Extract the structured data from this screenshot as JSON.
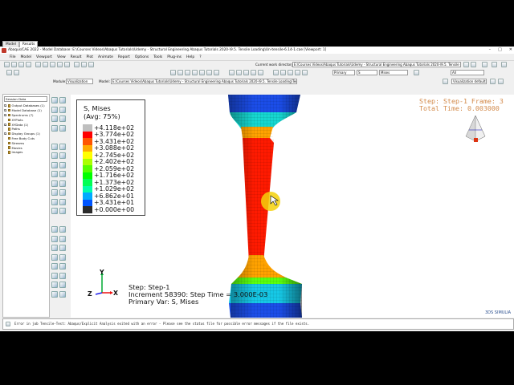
{
  "window": {
    "title": "Abaqus/CAE 2022 - Model Database: E:\\Courses Videos\\Abaqus Tutorials\\Udemy - Structural Engineering Abaqus Tutorials 2020-\\9.5. Tensile Loading\\Un-tensile-6.14-1.cae [Viewport: 1]"
  },
  "menu": [
    "File",
    "Model",
    "Viewport",
    "View",
    "Result",
    "Plot",
    "Animate",
    "Report",
    "Options",
    "Tools",
    "Plug-ins",
    "Help",
    "?"
  ],
  "toolbar": {
    "cwd_label": "Current work directory:",
    "cwd_value": "E:\\Courses Videos\\Abaqus Tutorials\\Udemy - Structural Engineering Abaqus Tutorials 2020-\\9.5. Tensile Loading",
    "all_value": "All",
    "primary_value": "Primary",
    "s_value": "S",
    "mises_value": "Mises",
    "vis_defaults": "Visualization defaults",
    "module_label": "Module:",
    "module_value": "Visualization",
    "model_label": "Model:",
    "model_value": "E:\\Courses Videos\\Abaqus Tutorials\\Udemy - Structural Engineering Abaqus Tutorials 2020-\\9.5. Tensile Loading\\Tensile-test.odb"
  },
  "panel": {
    "tabs": [
      "Model",
      "Results"
    ],
    "session": "Session Data",
    "tree": [
      {
        "label": "Output Databases (1)",
        "plus": true
      },
      {
        "label": "Model Database (1)",
        "plus": true
      },
      {
        "label": "Spectrums (7)",
        "plus": true
      },
      {
        "label": "XYPlots",
        "plus": false
      },
      {
        "label": "XYData (1)",
        "plus": true
      },
      {
        "label": "Paths",
        "plus": false
      },
      {
        "label": "Display Groups (1)",
        "plus": true
      },
      {
        "label": "Free Body Cuts",
        "plus": false
      },
      {
        "label": "Streams",
        "plus": false
      },
      {
        "label": "Movies",
        "plus": false
      },
      {
        "label": "Images",
        "plus": false
      }
    ]
  },
  "legend": {
    "title": "S, Mises",
    "subtitle": "(Avg: 75%)",
    "entries": [
      {
        "value": "+4.118e+02",
        "color": "#bfbfbf"
      },
      {
        "value": "+3.774e+02",
        "color": "#ff0000"
      },
      {
        "value": "+3.431e+02",
        "color": "#ff5500"
      },
      {
        "value": "+3.088e+02",
        "color": "#ffaa00"
      },
      {
        "value": "+2.745e+02",
        "color": "#ffff00"
      },
      {
        "value": "+2.402e+02",
        "color": "#aaff00"
      },
      {
        "value": "+2.059e+02",
        "color": "#55ff00"
      },
      {
        "value": "+1.716e+02",
        "color": "#00ff00"
      },
      {
        "value": "+1.373e+02",
        "color": "#00ff55"
      },
      {
        "value": "+1.029e+02",
        "color": "#00ffaa"
      },
      {
        "value": "+6.862e+01",
        "color": "#00aaff"
      },
      {
        "value": "+3.431e+01",
        "color": "#0055ff"
      },
      {
        "value": "+0.000e+00",
        "color": "#0000ff"
      }
    ],
    "last_color": "#2b2b2b"
  },
  "step_info": {
    "line1": "Step: Step-1   Frame: 3",
    "line2": "Total Time: 0.003000"
  },
  "triad": {
    "y": "Y",
    "z": "Z",
    "x": "X"
  },
  "viewport_text": {
    "step": "Step: Step-1",
    "increment": "Increment     58390: Step Time =    3.000E-03",
    "primary": "Primary Var: S, Mises"
  },
  "message": "Error in job Tensile-Test: Abaqus/Explicit Analysis exited with an error - Please see the  status file for possible error messages if the file exists.",
  "brand": "3DS SIMULIA",
  "colors": {
    "accent": "#d38a4a",
    "cursor": "#f5d10a"
  }
}
